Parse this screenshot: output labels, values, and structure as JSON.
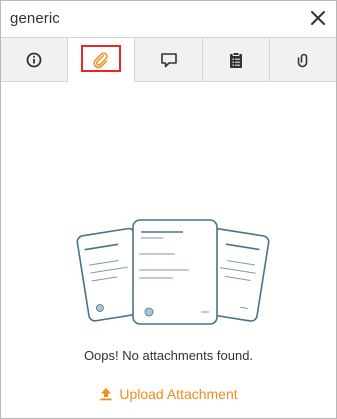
{
  "window": {
    "title": "generic"
  },
  "tabs": [
    {
      "id": "info",
      "icon": "info-icon"
    },
    {
      "id": "attachments",
      "icon": "paperclip-icon",
      "active": true
    },
    {
      "id": "comments",
      "icon": "comment-icon"
    },
    {
      "id": "tasks",
      "icon": "clipboard-icon"
    },
    {
      "id": "links",
      "icon": "link-icon"
    }
  ],
  "empty_state": {
    "message": "Oops! No attachments found.",
    "upload_label": "Upload Attachment"
  },
  "colors": {
    "accent": "#ee8e1f",
    "active_highlight": "#e5262b",
    "illustration_stroke": "#4a7389"
  }
}
